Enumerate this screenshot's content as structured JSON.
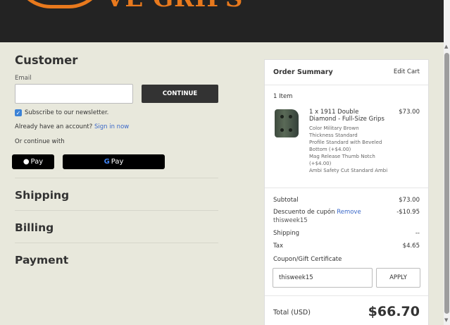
{
  "header": {
    "logo_text": "VE GRIPS"
  },
  "customer": {
    "title": "Customer",
    "email_label": "Email",
    "email_value": "",
    "continue_label": "CONTINUE",
    "newsletter_label": "Subscribe to our newsletter.",
    "newsletter_checked": true,
    "account_prompt": "Already have an account?",
    "sign_in_label": "Sign in now",
    "continue_with": "Or continue with",
    "apple_pay_label": "Pay",
    "google_pay_label": "Pay"
  },
  "steps": [
    "Shipping",
    "Billing",
    "Payment"
  ],
  "order_summary": {
    "title": "Order Summary",
    "edit_cart_label": "Edit Cart",
    "item_count": "1 Item",
    "item": {
      "name": "1 x 1911 Double Diamond - Full-Size Grips",
      "price": "$73.00",
      "options": [
        "Color Military Brown",
        "Thickness Standard",
        "Profile Standard with Beveled Bottom (+$4.00)",
        "Mag Release Thumb Notch (+$4.00)",
        "Ambi Safety Cut Standard Ambi"
      ]
    },
    "subtotal_label": "Subtotal",
    "subtotal_value": "$73.00",
    "discount_label": "Descuento de cupón",
    "discount_remove_label": "Remove",
    "discount_code": "thisweek15",
    "discount_value": "-$10.95",
    "shipping_label": "Shipping",
    "shipping_value": "--",
    "tax_label": "Tax",
    "tax_value": "$4.65",
    "coupon_label": "Coupon/Gift Certificate",
    "coupon_value": "thisweek15",
    "apply_label": "APPLY",
    "total_label": "Total (USD)",
    "total_value": "$66.70"
  },
  "colors": {
    "accent": "#e8791d",
    "link": "#3a68c8",
    "checkbox": "#3b82d6"
  }
}
